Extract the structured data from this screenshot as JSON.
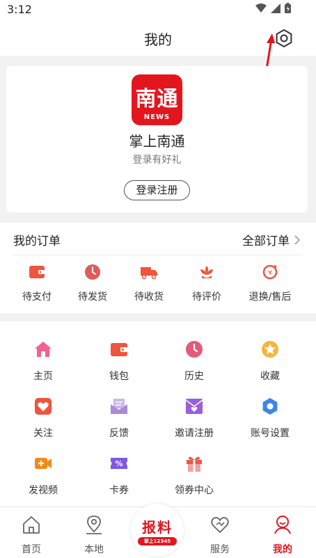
{
  "status_bar": {
    "time": "3:12"
  },
  "header": {
    "title": "我的"
  },
  "profile": {
    "logo_text": "南通",
    "logo_sub": "NEWS",
    "app_name": "掌上南通",
    "tip": "登录有好礼",
    "login_label": "登录注册"
  },
  "orders": {
    "title": "我的订单",
    "all_label": "全部订单",
    "items": [
      {
        "label": "待支付",
        "icon": "wallet-icon"
      },
      {
        "label": "待发货",
        "icon": "clock-icon"
      },
      {
        "label": "待收货",
        "icon": "truck-icon"
      },
      {
        "label": "待评价",
        "icon": "flower-icon"
      },
      {
        "label": "退换/售后",
        "icon": "refund-icon"
      }
    ]
  },
  "services": {
    "items": [
      {
        "label": "主页",
        "icon": "home-icon",
        "color": "#f06292"
      },
      {
        "label": "钱包",
        "icon": "wallet-icon",
        "color": "#f0543c"
      },
      {
        "label": "历史",
        "icon": "clock-icon",
        "color": "#e25a7c"
      },
      {
        "label": "收藏",
        "icon": "star-icon",
        "color": "#f7b53e"
      },
      {
        "label": "关注",
        "icon": "heart-icon",
        "color": "#f0543c"
      },
      {
        "label": "反馈",
        "icon": "mail-icon",
        "color": "#a98bd8"
      },
      {
        "label": "邀请注册",
        "icon": "invite-icon",
        "color": "#9a5ee0"
      },
      {
        "label": "账号设置",
        "icon": "gear-icon",
        "color": "#3d86e6"
      },
      {
        "label": "发视频",
        "icon": "video-icon",
        "color": "#f28a1a"
      },
      {
        "label": "卡券",
        "icon": "coupon-icon",
        "color": "#8057e6"
      },
      {
        "label": "领券中心",
        "icon": "gift-icon",
        "color": "#e85a4a"
      }
    ]
  },
  "tab_bar": {
    "items": [
      {
        "label": "首页",
        "icon": "home-outline-icon"
      },
      {
        "label": "本地",
        "icon": "location-icon"
      },
      {
        "label": "服务",
        "icon": "heart-outline-icon"
      },
      {
        "label": "我的",
        "icon": "user-icon"
      }
    ],
    "report_label": "报料",
    "report_sub": "掌上12345"
  },
  "colors": {
    "brand_red": "#e3161e",
    "background": "#f2f2f2"
  }
}
